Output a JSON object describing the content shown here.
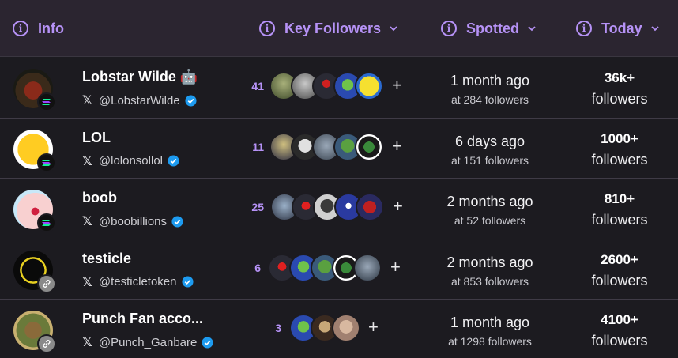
{
  "header": {
    "info_label": "Info",
    "key_followers_label": "Key Followers",
    "spotted_label": "Spotted",
    "today_label": "Today",
    "accent_color": "#b692f6"
  },
  "rows": [
    {
      "name": "Lobstar Wilde 🤖",
      "handle": "@LobstarWilde",
      "chain_badge": "solana-icon",
      "key_count": "41",
      "spotted_ago": "1 month ago",
      "spotted_at": "at 284 followers",
      "today_count": "36k+",
      "today_label": "followers"
    },
    {
      "name": "LOL",
      "handle": "@lolonsollol",
      "chain_badge": "solana-icon",
      "key_count": "11",
      "spotted_ago": "6 days ago",
      "spotted_at": "at 151 followers",
      "today_count": "1000+",
      "today_label": "followers"
    },
    {
      "name": "boob",
      "handle": "@boobillions",
      "chain_badge": "solana-icon",
      "key_count": "25",
      "spotted_ago": "2 months ago",
      "spotted_at": "at 52 followers",
      "today_count": "810+",
      "today_label": "followers"
    },
    {
      "name": "testicle",
      "handle": "@testicletoken",
      "chain_badge": "link-icon",
      "key_count": "6",
      "spotted_ago": "2 months ago",
      "spotted_at": "at 853 followers",
      "today_count": "2600+",
      "today_label": "followers"
    },
    {
      "name": "Punch Fan acco...",
      "handle": "@Punch_Ganbare",
      "chain_badge": "link-icon",
      "key_count": "3",
      "spotted_ago": "1 month ago",
      "spotted_at": "at 1298 followers",
      "today_count": "4100+",
      "today_label": "followers"
    }
  ]
}
